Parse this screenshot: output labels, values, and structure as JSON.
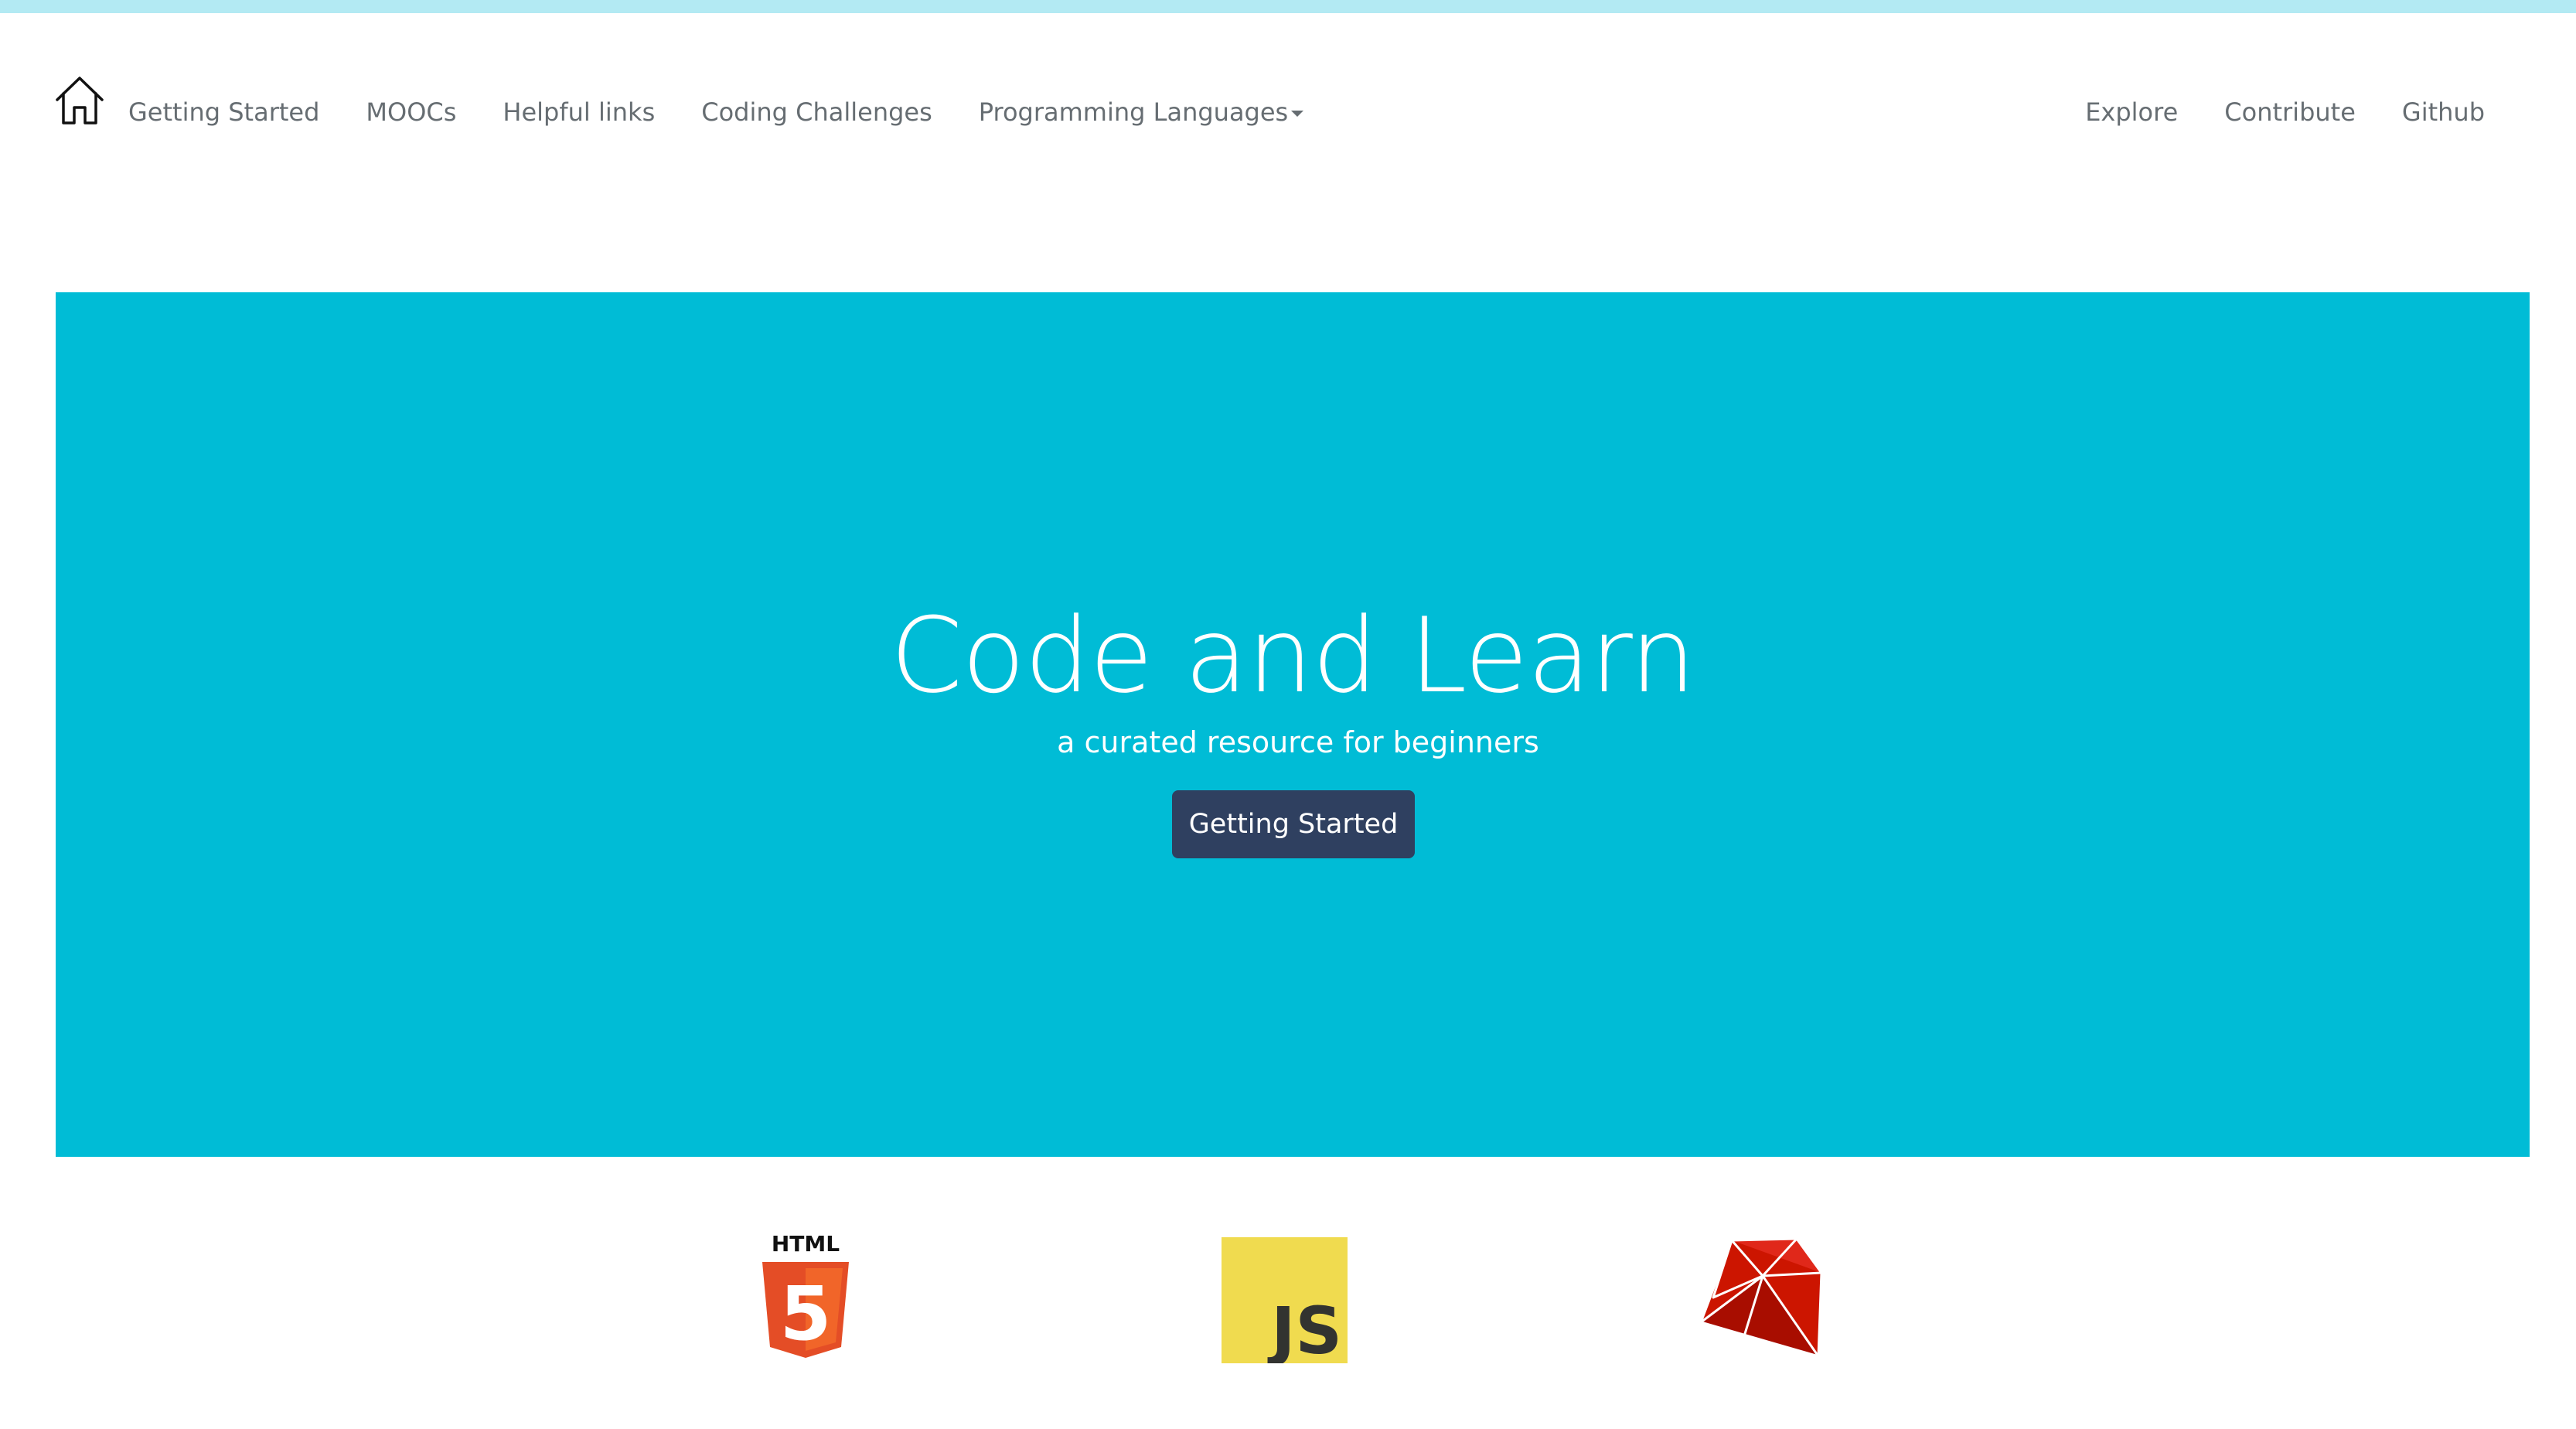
{
  "nav": {
    "home_icon": "home-icon",
    "left_links": [
      {
        "label": "Getting Started"
      },
      {
        "label": "MOOCs"
      },
      {
        "label": "Helpful links"
      },
      {
        "label": "Coding Challenges"
      },
      {
        "label": "Programming Languages",
        "has_dropdown": true
      }
    ],
    "right_links": [
      {
        "label": "Explore"
      },
      {
        "label": "Contribute"
      },
      {
        "label": "Github"
      }
    ]
  },
  "hero": {
    "title": "Code and Learn",
    "subtitle": "a curated resource for beginners",
    "button_label": "Getting Started",
    "background_color": "#00bcd6",
    "button_color": "#2f4060"
  },
  "languages": [
    {
      "icon": "html5-icon",
      "text": "HTML",
      "badge": "5",
      "color": "#e44d26"
    },
    {
      "icon": "javascript-icon",
      "text": "JS",
      "color": "#f0db4f"
    },
    {
      "icon": "ruby-icon",
      "color": "#cc1500"
    }
  ],
  "colors": {
    "top_strip": "#b3eaf3",
    "nav_text": "#666d72"
  }
}
